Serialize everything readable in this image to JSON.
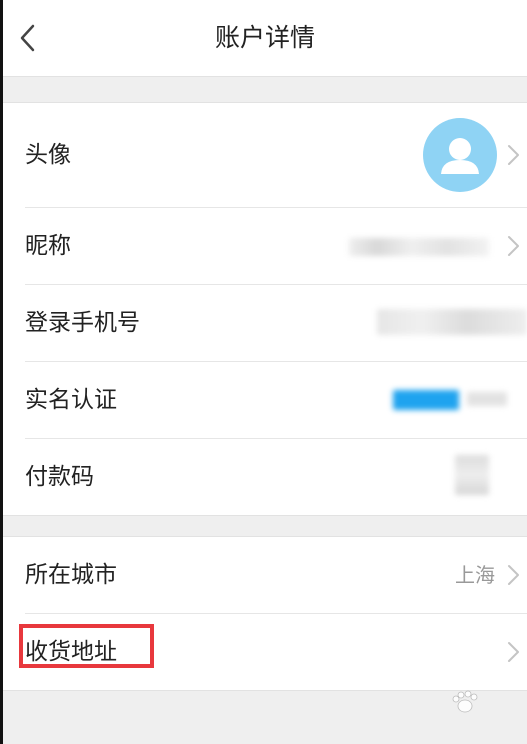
{
  "header": {
    "title": "账户详情"
  },
  "group1": {
    "items": [
      {
        "label": "头像"
      },
      {
        "label": "昵称"
      },
      {
        "label": "登录手机号"
      },
      {
        "label": "实名认证"
      },
      {
        "label": "付款码"
      }
    ]
  },
  "group2": {
    "items": [
      {
        "label": "所在城市",
        "value": "上海"
      },
      {
        "label": "收货地址"
      }
    ]
  },
  "colors": {
    "avatar_bg": "#8fd3f4",
    "highlight": "#e8383d",
    "page_bg": "#efefef"
  },
  "icons": {
    "back": "chevron-left-icon",
    "row": "chevron-right-icon",
    "avatar": "user-silhouette-icon"
  }
}
